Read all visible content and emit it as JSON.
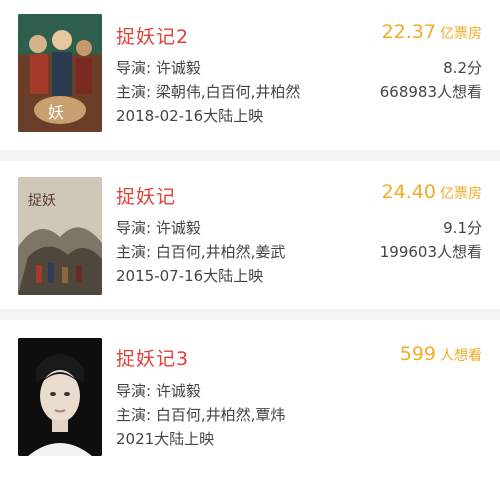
{
  "movies": [
    {
      "title": "捉妖记2",
      "metric_value": "22.37",
      "metric_unit": "亿票房",
      "director": "导演: 许诚毅",
      "cast": "主演: 梁朝伟,白百何,井柏然",
      "release": "2018-02-16大陆上映",
      "score": "8.2分",
      "wants": "668983人想看",
      "poster_colors": [
        "#2e5e4d",
        "#c7a06e",
        "#8a2c25"
      ]
    },
    {
      "title": "捉妖记",
      "metric_value": "24.40",
      "metric_unit": "亿票房",
      "director": "导演: 许诚毅",
      "cast": "主演: 白百何,井柏然,姜武",
      "release": "2015-07-16大陆上映",
      "score": "9.1分",
      "wants": "199603人想看",
      "poster_colors": [
        "#d9d3c6",
        "#8c8577",
        "#3c342c"
      ]
    },
    {
      "title": "捉妖记3",
      "metric_value": "599",
      "metric_unit": "人想看",
      "director": "导演: 许诚毅",
      "cast": "主演: 白百何,井柏然,覃炜",
      "release": "2021大陆上映",
      "poster_colors": [
        "#111111",
        "#e8d9cc"
      ]
    }
  ],
  "colors": {
    "title": "#e0413a",
    "metric": "#f0ac25",
    "text": "#444444",
    "background": "#f3f3f3"
  }
}
